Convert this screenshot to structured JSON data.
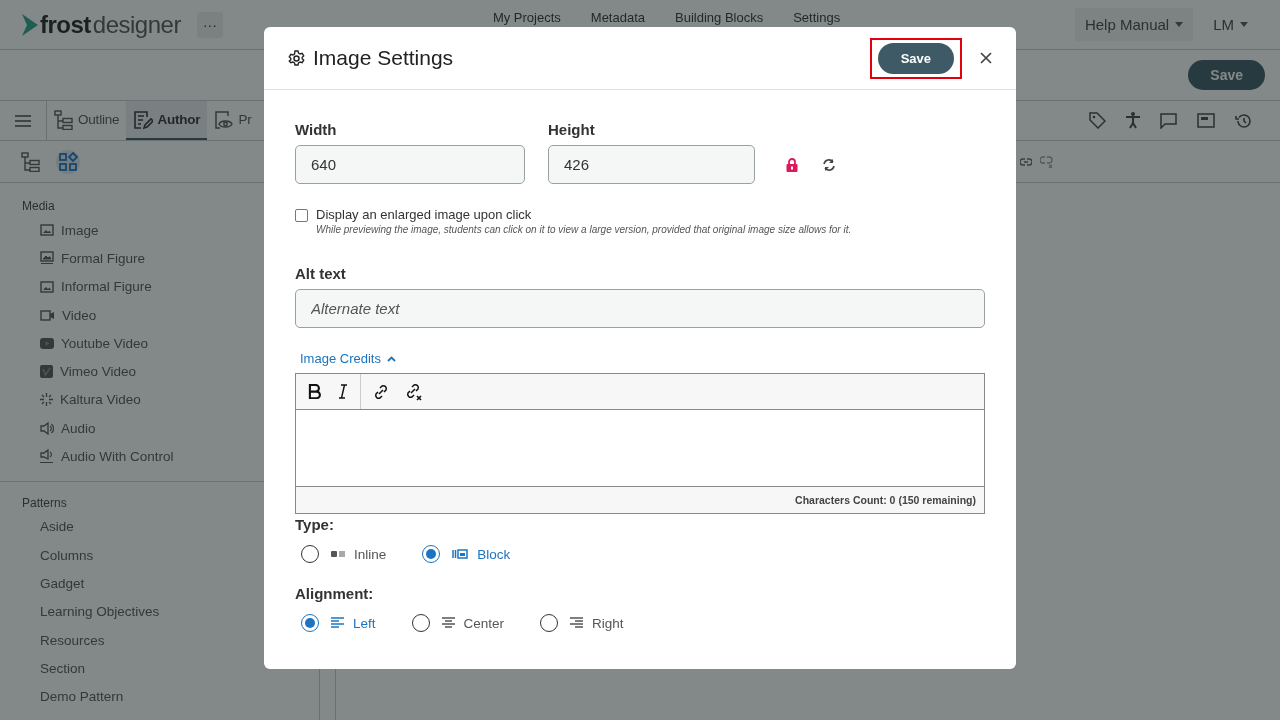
{
  "header": {
    "brand": "frost",
    "product": "designer",
    "more": "···",
    "nav": [
      {
        "label": "My Projects"
      },
      {
        "label": "Metadata"
      },
      {
        "label": "Building Blocks"
      },
      {
        "label": "Settings"
      }
    ],
    "help_menu": "Help Manual",
    "user_menu": "LM"
  },
  "page_save": "Save",
  "tabs": [
    {
      "label": "Outline",
      "kind": "outline",
      "selected": false
    },
    {
      "label": "Author",
      "kind": "author",
      "selected": true
    },
    {
      "label": "Pr",
      "kind": "preview",
      "selected": false
    }
  ],
  "view_toggles": [
    {
      "kind": "tree",
      "selected": false
    },
    {
      "kind": "blocks",
      "selected": true
    }
  ],
  "sidebar": {
    "sections": [
      {
        "title": "Media",
        "items": [
          {
            "label": "Image",
            "kind": "image"
          },
          {
            "label": "Formal Figure",
            "kind": "figure"
          },
          {
            "label": "Informal Figure",
            "kind": "image"
          },
          {
            "label": "Video",
            "kind": "video"
          },
          {
            "label": "Youtube Video",
            "kind": "youtube"
          },
          {
            "label": "Vimeo Video",
            "kind": "vimeo"
          },
          {
            "label": "Kaltura Video",
            "kind": "kaltura"
          },
          {
            "label": "Audio",
            "kind": "audio"
          },
          {
            "label": "Audio With Control",
            "kind": "audio-control"
          }
        ]
      },
      {
        "title": "Patterns",
        "items": [
          {
            "label": "Aside",
            "kind": "plain"
          },
          {
            "label": "Columns",
            "kind": "plain"
          },
          {
            "label": "Gadget",
            "kind": "plain"
          },
          {
            "label": "Learning Objectives",
            "kind": "plain"
          },
          {
            "label": "Resources",
            "kind": "plain"
          },
          {
            "label": "Section",
            "kind": "plain"
          },
          {
            "label": "Demo Pattern",
            "kind": "plain"
          }
        ]
      }
    ]
  },
  "dialog": {
    "title": "Image Settings",
    "save": "Save",
    "save_highlighted": true,
    "width": {
      "label": "Width",
      "value": "640"
    },
    "height": {
      "label": "Height",
      "value": "426"
    },
    "aspect_locked": true,
    "enlarge": {
      "label": "Display an enlarged image upon click",
      "hint": "While previewing the image, students can click on it to view a large version, provided that original image size allows for it.",
      "checked": false
    },
    "alt_text": {
      "label": "Alt text",
      "placeholder": "Alternate text"
    },
    "credits": {
      "label": "Image Credits",
      "expanded": true,
      "char_count": "Characters Count: 0 (150 remaining)"
    },
    "type": {
      "label": "Type:",
      "options": [
        {
          "label": "Inline",
          "kind": "inline",
          "selected": false
        },
        {
          "label": "Block",
          "kind": "block",
          "selected": true
        }
      ]
    },
    "alignment": {
      "label": "Alignment:",
      "options": [
        {
          "label": "Left",
          "kind": "left",
          "selected": true
        },
        {
          "label": "Center",
          "kind": "center",
          "selected": false
        },
        {
          "label": "Right",
          "kind": "right",
          "selected": false
        }
      ]
    }
  }
}
